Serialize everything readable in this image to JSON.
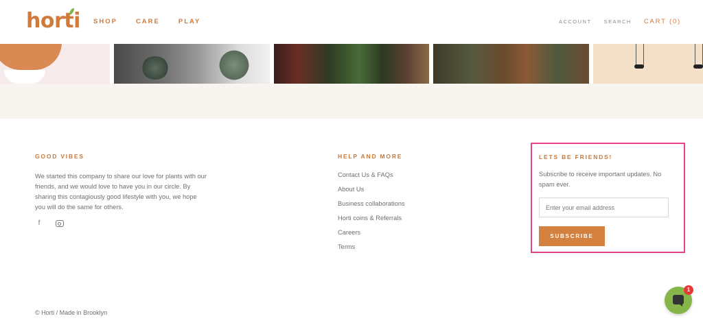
{
  "header": {
    "logo": "horti",
    "nav_left": [
      "SHOP",
      "CARE",
      "PLAY"
    ],
    "nav_right": {
      "account": "ACCOUNT",
      "search": "SEARCH",
      "cart": "CART (0)"
    }
  },
  "footer": {
    "good_vibes": {
      "title": "GOOD VIBES",
      "text": "We started this company to share our love for plants with our friends, and we would love to have you in our circle. By sharing this contagiously good lifestyle with you, we hope you will do the same for others.",
      "social_icons": [
        "facebook-icon",
        "instagram-icon"
      ]
    },
    "help": {
      "title": "HELP AND MORE",
      "links": [
        "Contact Us & FAQs",
        "About Us",
        "Business collaborations",
        "Horti coins & Referrals",
        "Careers",
        "Terms"
      ]
    },
    "newsletter": {
      "title": "LETS BE FRIENDS!",
      "text": "Subscribe to receive important updates. No spam ever.",
      "email_placeholder": "Enter your email address",
      "button": "SUBSCRIBE",
      "highlight_color": "#e8418a"
    },
    "copyright": "© Horti / Made in Brooklyn"
  },
  "chat": {
    "badge_count": "1"
  },
  "colors": {
    "accent": "#d07a3c",
    "chat_green": "#86b54a"
  }
}
